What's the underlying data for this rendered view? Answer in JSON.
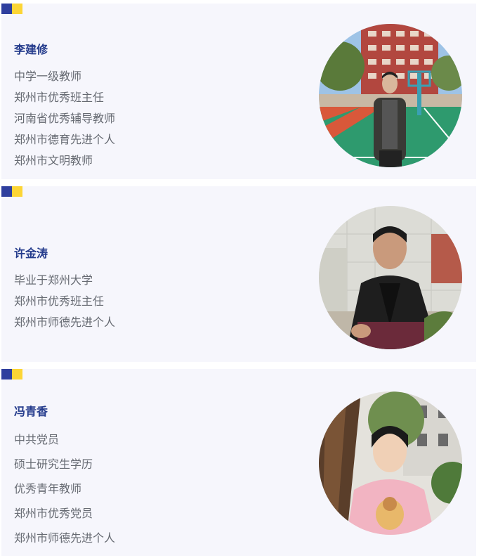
{
  "profiles": [
    {
      "name": "李建修",
      "titles": [
        "中学一级教师",
        "郑州市优秀班主任",
        "河南省优秀辅导教师",
        "郑州市德育先进个人",
        "郑州市文明教师"
      ]
    },
    {
      "name": "许金涛",
      "titles": [
        "毕业于郑州大学",
        "郑州市优秀班主任",
        "郑州市师德先进个人"
      ]
    },
    {
      "name": "冯青香",
      "titles": [
        "中共党员",
        "硕士研究生学历",
        "优秀青年教师",
        "郑州市优秀党员",
        "郑州市师德先进个人"
      ]
    }
  ],
  "colors": {
    "accent_blue": "#2f3f9e",
    "accent_yellow": "#fcd535",
    "name_text": "#243b8c",
    "body_text": "#666a72",
    "card_bg": "#f6f6fc"
  },
  "icons": [
    "corner-mark",
    "portrait-photo"
  ]
}
